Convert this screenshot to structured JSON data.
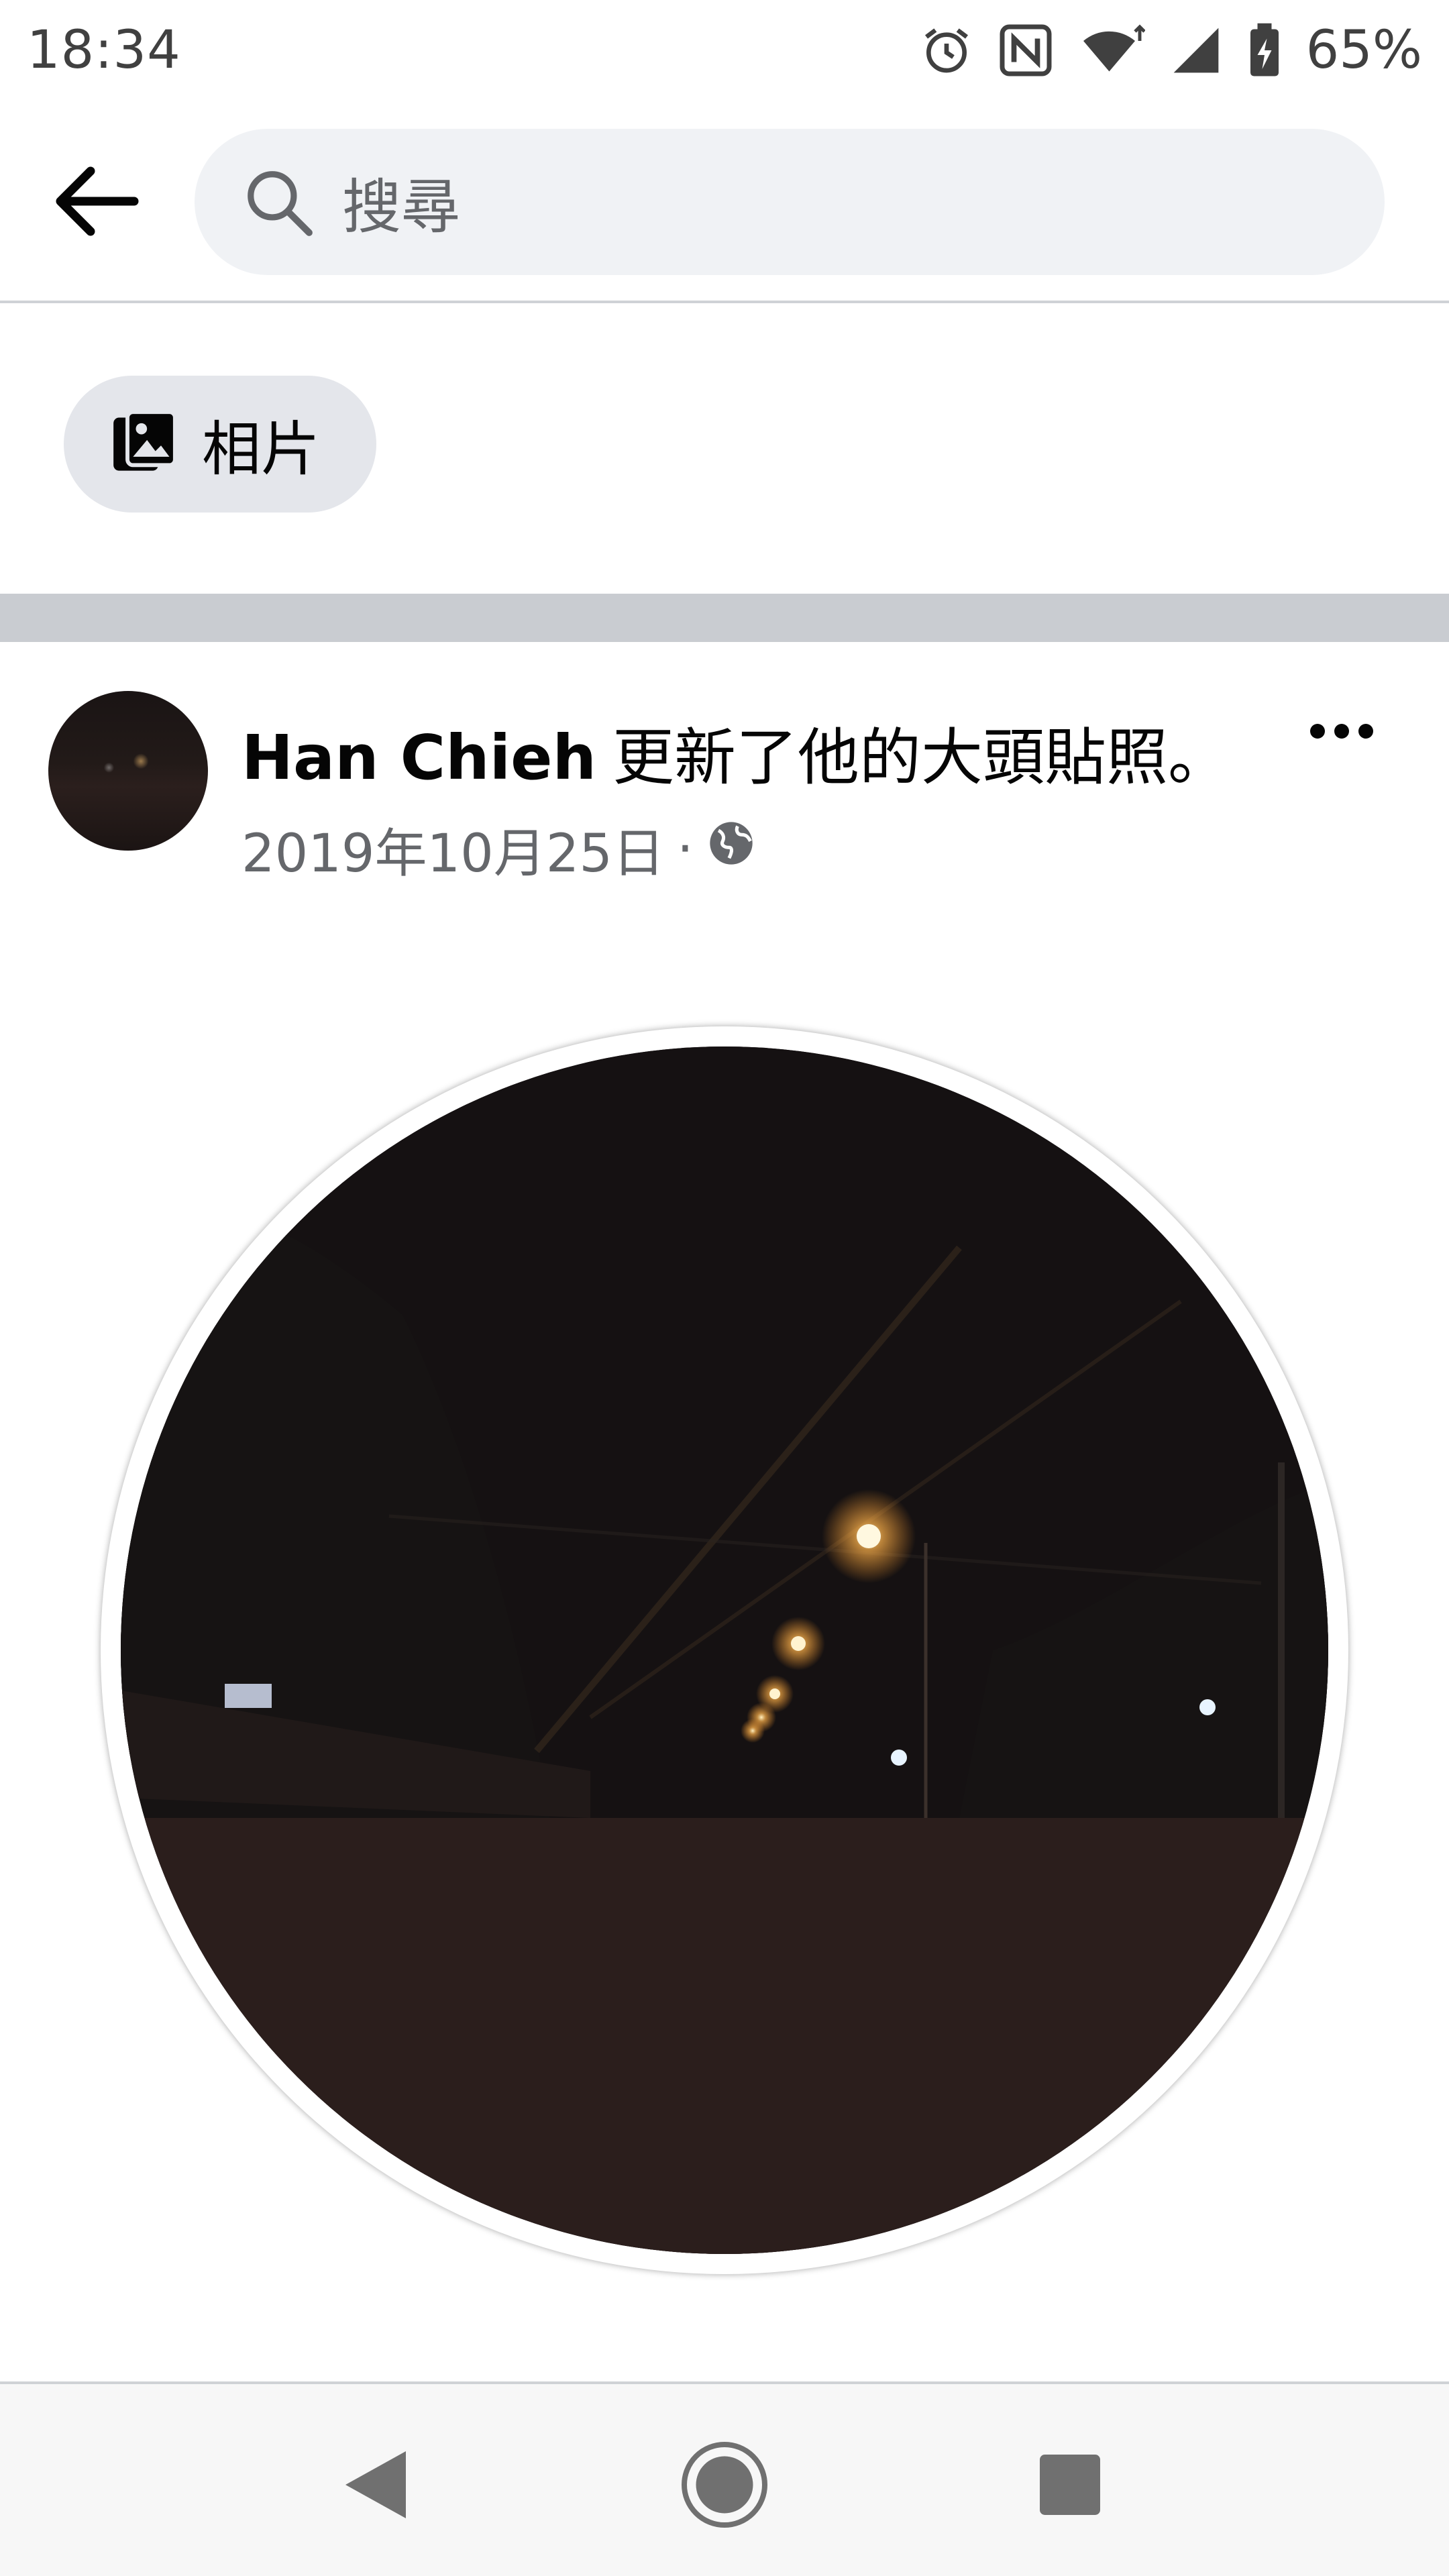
{
  "status_bar": {
    "time": "18:34",
    "icons": [
      "alarm-icon",
      "nfc-icon",
      "wifi-icon",
      "signal-icon",
      "battery-charging-icon"
    ],
    "battery": "65%"
  },
  "search": {
    "placeholder": "搜尋"
  },
  "filters": [
    {
      "label": "相片",
      "icon": "photos-icon"
    }
  ],
  "post": {
    "author": "Han Chieh",
    "action": "更新了他的大頭貼照。",
    "date": "2019年10月25日",
    "separator": "·",
    "privacy_icon": "globe-icon"
  },
  "nav": {
    "icons": [
      "nav-back-icon",
      "nav-home-icon",
      "nav-recents-icon"
    ]
  }
}
